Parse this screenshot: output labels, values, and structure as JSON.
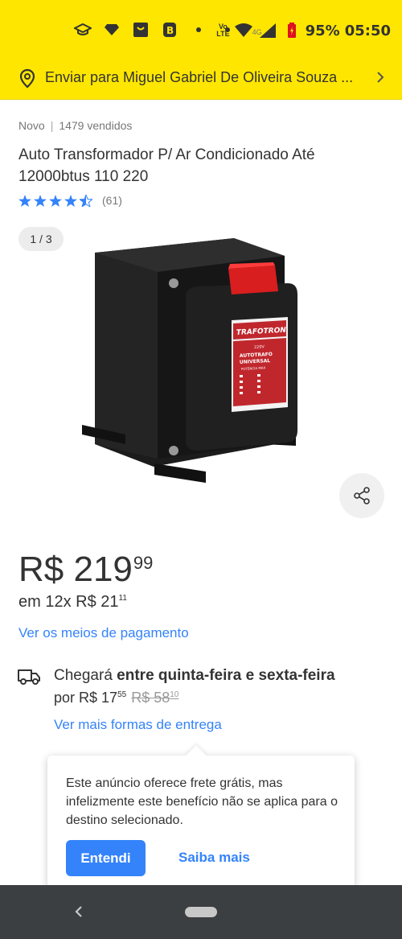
{
  "status_bar": {
    "battery": "95%",
    "time": "05:50",
    "network": "4G",
    "volte": "Vo LTE",
    "icons": [
      "graduation-cap-icon",
      "diamond-icon",
      "shopping-bag-icon",
      "b-app-icon",
      "dot-icon",
      "dot-icon",
      "volte-icon",
      "wifi-icon",
      "signal-icon",
      "battery-icon"
    ]
  },
  "shipping_bar": {
    "text": "Enviar para Miguel Gabriel De Oliveira Souza ..."
  },
  "product": {
    "condition": "Novo",
    "sold": "1479 vendidos",
    "title": "Auto Transformador  P/ Ar Condicionado Até 12000btus 110 220",
    "rating": 4.5,
    "reviews": "(61)",
    "image_counter": "1 / 3",
    "image_labels": {
      "brand": "TRAFOTRON",
      "voltage": "220V",
      "line1": "AUTOTRAFO",
      "line2": "UNIVERSAL",
      "line3": "POTÊNCIA MAX"
    }
  },
  "price": {
    "currency": "R$",
    "integer": "219",
    "cents": "99",
    "installments_prefix": "em 12x R$",
    "installment_integer": "21",
    "installment_cents": "11",
    "payment_link": "Ver os meios de pagamento"
  },
  "delivery": {
    "arrival_prefix": "Chegará",
    "arrival_window": "entre quinta-feira e sexta-feira",
    "price_prefix": "por R$",
    "price_integer": "17",
    "price_cents": "55",
    "old_price": "R$ 58",
    "old_cents": "10",
    "more_link": "Ver mais formas de entrega"
  },
  "tooltip": {
    "message": "Este anúncio oferece frete grátis, mas infelizmente este benefício não se aplica para o destino selecionado.",
    "ok_button": "Entendi",
    "more_button": "Saiba mais"
  },
  "colors": {
    "brand_yellow": "#fee600",
    "accent_blue": "#3483fa",
    "text": "#333333",
    "nav_bar": "#3b3f42"
  }
}
